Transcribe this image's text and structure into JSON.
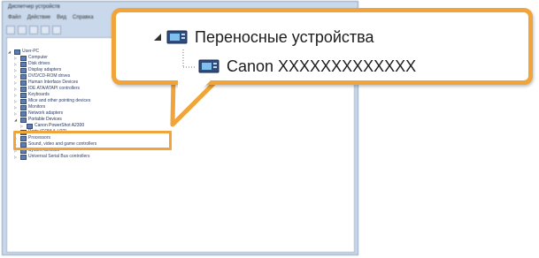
{
  "window": {
    "title": "Диспетчер устройств",
    "menu": [
      "Файл",
      "Действие",
      "Вид",
      "Справка"
    ]
  },
  "tree": [
    {
      "label": "User-PC",
      "indent": 0,
      "expanded": true
    },
    {
      "label": "Computer",
      "indent": 1
    },
    {
      "label": "Disk drives",
      "indent": 1
    },
    {
      "label": "Display adapters",
      "indent": 1
    },
    {
      "label": "DVD/CD-ROM drives",
      "indent": 1
    },
    {
      "label": "Human Interface Devices",
      "indent": 1
    },
    {
      "label": "IDE ATA/ATAPI controllers",
      "indent": 1
    },
    {
      "label": "Keyboards",
      "indent": 1
    },
    {
      "label": "Mice and other pointing devices",
      "indent": 1
    },
    {
      "label": "Monitors",
      "indent": 1
    },
    {
      "label": "Network adapters",
      "indent": 1
    },
    {
      "label": "Portable Devices",
      "indent": 1,
      "expanded": true,
      "highlight": true
    },
    {
      "label": "Canon PowerShot A2300",
      "indent": 2,
      "highlight": true
    },
    {
      "label": "Ports (COM & LPT)",
      "indent": 1
    },
    {
      "label": "Processors",
      "indent": 1
    },
    {
      "label": "Sound, video and game controllers",
      "indent": 1
    },
    {
      "label": "System devices",
      "indent": 1
    },
    {
      "label": "Universal Serial Bus controllers",
      "indent": 1
    }
  ],
  "callout": {
    "category": "Переносные устройства",
    "device": "Canon XXXXXXXXXXXXX"
  },
  "colors": {
    "accent": "#f0a43a"
  }
}
